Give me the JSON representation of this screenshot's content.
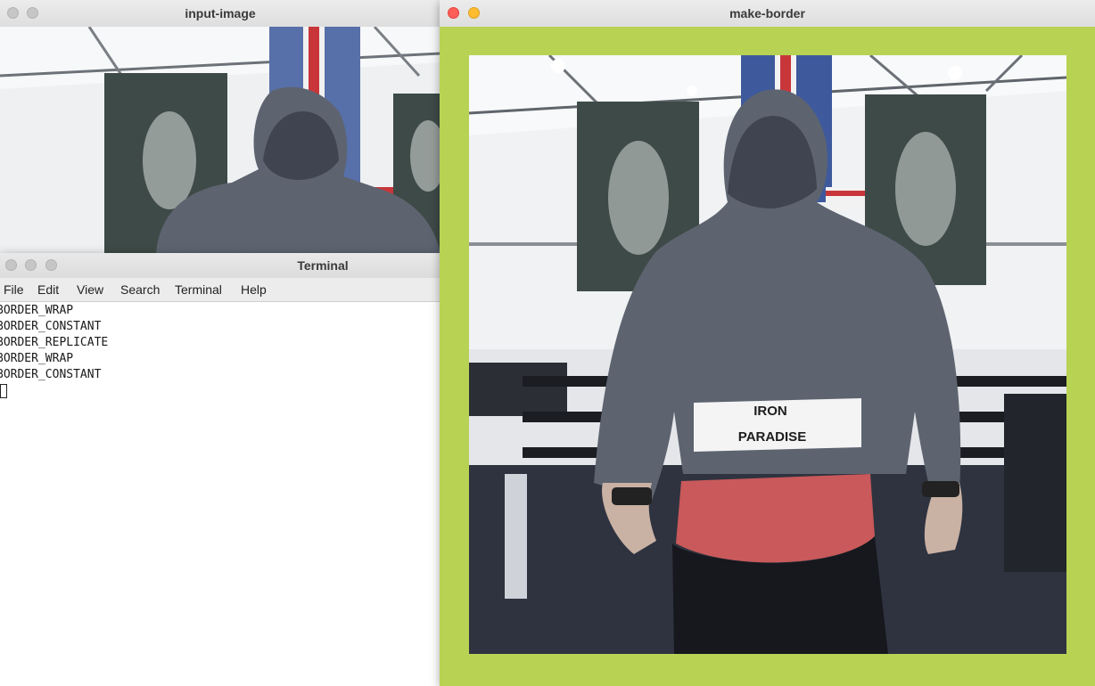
{
  "windows": {
    "input": {
      "title": "input-image"
    },
    "terminal": {
      "title": "Terminal",
      "menu": [
        "File",
        "Edit",
        "View",
        "Search",
        "Terminal",
        "Help"
      ],
      "lines": [
        "BORDER_WRAP",
        "BORDER_CONSTANT",
        "BORDER_REPLICATE",
        "BORDER_WRAP",
        "BORDER_CONSTANT"
      ]
    },
    "border": {
      "title": "make-border",
      "border_color": "#b8d254"
    }
  },
  "photo": {
    "belt_line1": "IRON",
    "belt_line2": "PARADISE"
  },
  "icons": {
    "window_controls": [
      "close-icon",
      "minimize-icon",
      "maximize-icon"
    ]
  }
}
